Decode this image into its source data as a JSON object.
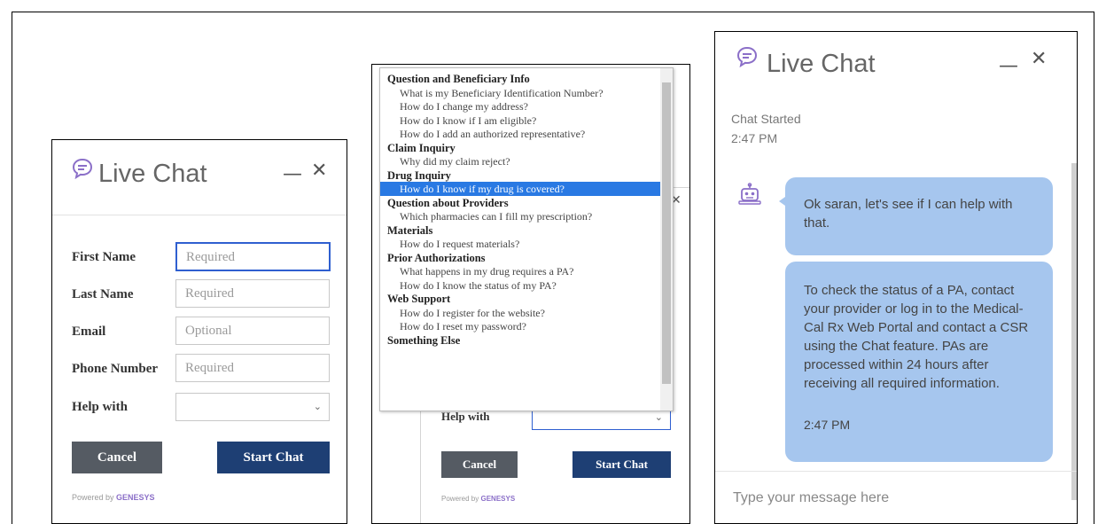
{
  "colors": {
    "title_gray": "#666666",
    "accent_purple": "#8b6fc8",
    "cancel_bg": "#555b63",
    "start_bg": "#1e3f74",
    "input_focus": "#2f5fd0",
    "dropdown_selected": "#2979e3",
    "chat_bubble": "#a6c6ee"
  },
  "panel1": {
    "title": "Live Chat",
    "minimize": "—",
    "close": "✕",
    "fields": [
      {
        "label": "First Name",
        "placeholder": "Required"
      },
      {
        "label": "Last Name",
        "placeholder": "Required"
      },
      {
        "label": "Email",
        "placeholder": "Optional"
      },
      {
        "label": "Phone Number",
        "placeholder": "Required"
      }
    ],
    "help_label": "Help with",
    "help_value": "",
    "cancel_label": "Cancel",
    "start_label": "Start Chat",
    "powered_prefix": "Powered by",
    "powered_brand": "GENESYS"
  },
  "panel2": {
    "dropdown": [
      {
        "type": "group",
        "text": "Question and Beneficiary Info"
      },
      {
        "type": "option",
        "text": "What is my Beneficiary Identification Number?"
      },
      {
        "type": "option",
        "text": "How do I change my address?"
      },
      {
        "type": "option",
        "text": "How do I know if I am eligible?"
      },
      {
        "type": "option",
        "text": "How do I add an authorized representative?"
      },
      {
        "type": "group",
        "text": "Claim Inquiry"
      },
      {
        "type": "option",
        "text": "Why did my claim reject?"
      },
      {
        "type": "group",
        "text": "Drug Inquiry"
      },
      {
        "type": "option",
        "text": "How do I know if my drug is covered?",
        "selected": true
      },
      {
        "type": "group",
        "text": "Question about Providers"
      },
      {
        "type": "option",
        "text": "Which pharmacies can I fill my prescription?"
      },
      {
        "type": "group",
        "text": "Materials"
      },
      {
        "type": "option",
        "text": "How do I request materials?"
      },
      {
        "type": "group",
        "text": "Prior Authorizations"
      },
      {
        "type": "option",
        "text": "What happens in my drug requires a PA?"
      },
      {
        "type": "option",
        "text": "How do I know the status of my PA?"
      },
      {
        "type": "group",
        "text": "Web Support"
      },
      {
        "type": "option",
        "text": "How do I register for the website?"
      },
      {
        "type": "option",
        "text": "How do I reset my password?"
      },
      {
        "type": "group",
        "text": "Something Else"
      }
    ],
    "help_label": "Help with",
    "cancel_label": "Cancel",
    "start_label": "Start Chat",
    "powered_prefix": "Powered by",
    "powered_brand": "GENESYS",
    "close": "✕"
  },
  "panel3": {
    "title": "Live Chat",
    "minimize": "—",
    "close": "✕",
    "chat_started": "Chat Started",
    "chat_started_time": "2:47 PM",
    "messages": [
      {
        "text": "Ok saran, let's see if I can help with that."
      },
      {
        "text": "To check the status of a PA, contact your provider or log in to the Medical-Cal Rx Web Portal and contact a CSR using the Chat feature. PAs are processed within 24 hours after receiving all required information.",
        "time": "2:47 PM"
      }
    ],
    "input_placeholder": "Type your message here"
  }
}
